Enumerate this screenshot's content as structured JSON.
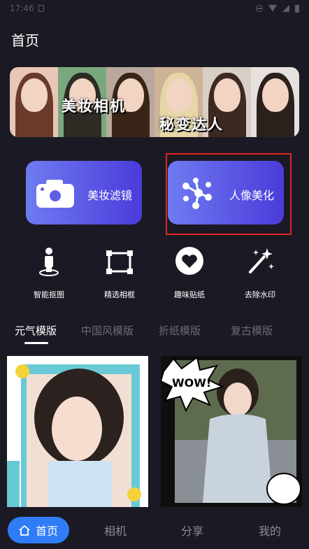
{
  "status_bar": {
    "time": "17:46"
  },
  "page": {
    "title": "首页"
  },
  "banner": {
    "title_left": "美妆相机",
    "title_right": "秘变达人"
  },
  "features": [
    {
      "label": "美妆滤镜",
      "icon": "camera-icon"
    },
    {
      "label": "人像美化",
      "icon": "ai-molecule-icon"
    }
  ],
  "tools": [
    {
      "label": "智能抠图",
      "icon": "person-cutout-icon"
    },
    {
      "label": "精选相框",
      "icon": "photo-frame-icon"
    },
    {
      "label": "趣味贴纸",
      "icon": "heart-sticker-icon"
    },
    {
      "label": "去除水印",
      "icon": "magic-wand-icon"
    }
  ],
  "tabs": [
    "元气模版",
    "中国风模版",
    "折纸模版",
    "复古模版"
  ],
  "active_tab": "元气模版",
  "thumbnails": [
    {
      "label": "cyan-frame-portrait"
    },
    {
      "label": "comic-wow-portrait",
      "text": "WOW!"
    }
  ],
  "nav": {
    "items": [
      "首页",
      "相机",
      "分享",
      "我的"
    ],
    "active": "首页"
  },
  "colors": {
    "background": "#1b1a24",
    "card_gradient_start": "#6f7bf0",
    "card_gradient_end": "#4b3bdb",
    "nav_active": "#2f7cf6",
    "highlight": "#e02626",
    "tab_inactive": "#6d6c76"
  }
}
